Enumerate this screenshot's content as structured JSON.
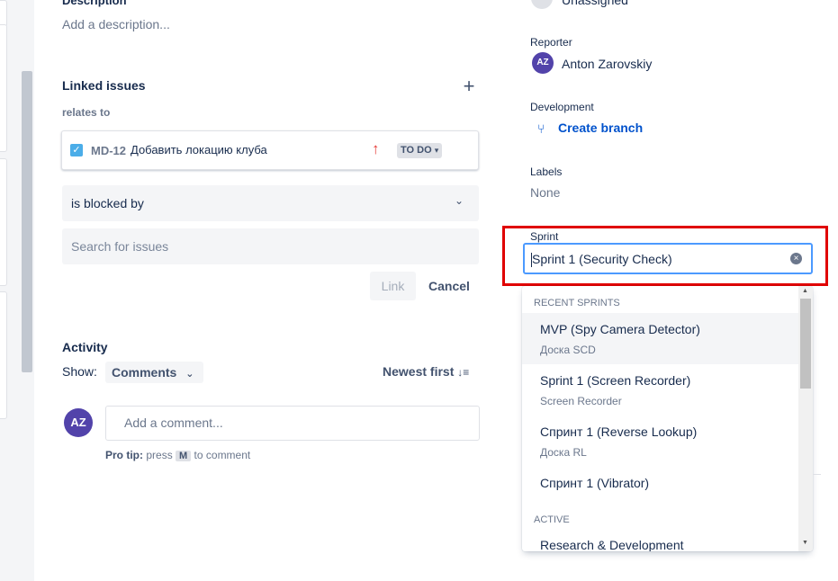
{
  "description": {
    "title": "Description",
    "placeholder": "Add a description..."
  },
  "linked_issues": {
    "title": "Linked issues",
    "add_icon": "plus-icon",
    "relation_label": "relates to",
    "issue": {
      "key": "MD-12",
      "summary": "Добавить локацию клуба",
      "priority_icon": "arrow-up-icon",
      "status": "TO DO"
    },
    "link_type": "is blocked by",
    "search_placeholder": "Search for issues",
    "link_button": "Link",
    "cancel_button": "Cancel"
  },
  "activity": {
    "title": "Activity",
    "show_label": "Show:",
    "filter": "Comments",
    "sort": "Newest first",
    "avatar_initials": "AZ",
    "comment_placeholder": "Add a comment...",
    "protip_prefix": "Pro tip:",
    "protip_press": "press",
    "protip_key": "M",
    "protip_suffix": "to comment"
  },
  "details": {
    "assignee": "Unassigned",
    "reporter_label": "Reporter",
    "reporter_initials": "AZ",
    "reporter_name": "Anton Zarovskiy",
    "development_label": "Development",
    "create_branch": "Create branch",
    "labels_label": "Labels",
    "labels_value": "None",
    "sprint_label": "Sprint",
    "sprint_value": "Sprint 1 (Security Check)"
  },
  "sprint_dropdown": {
    "group_recent": "RECENT SPRINTS",
    "items": [
      {
        "title": "MVP (Spy Camera Detector)",
        "board": "Доска SCD"
      },
      {
        "title": "Sprint 1 (Screen Recorder)",
        "board": "Screen Recorder"
      },
      {
        "title": "Спринт 1 (Reverse Lookup)",
        "board": "Доска RL"
      },
      {
        "title": "Спринт 1 (Vibrator)",
        "board": ""
      }
    ],
    "group_active": "ACTIVE",
    "active_items": [
      {
        "title": "Research & Development"
      }
    ]
  },
  "colors": {
    "accent": "#0052cc",
    "avatar": "#5243aa",
    "highlight": "#e00000",
    "focus": "#4c9aff"
  }
}
